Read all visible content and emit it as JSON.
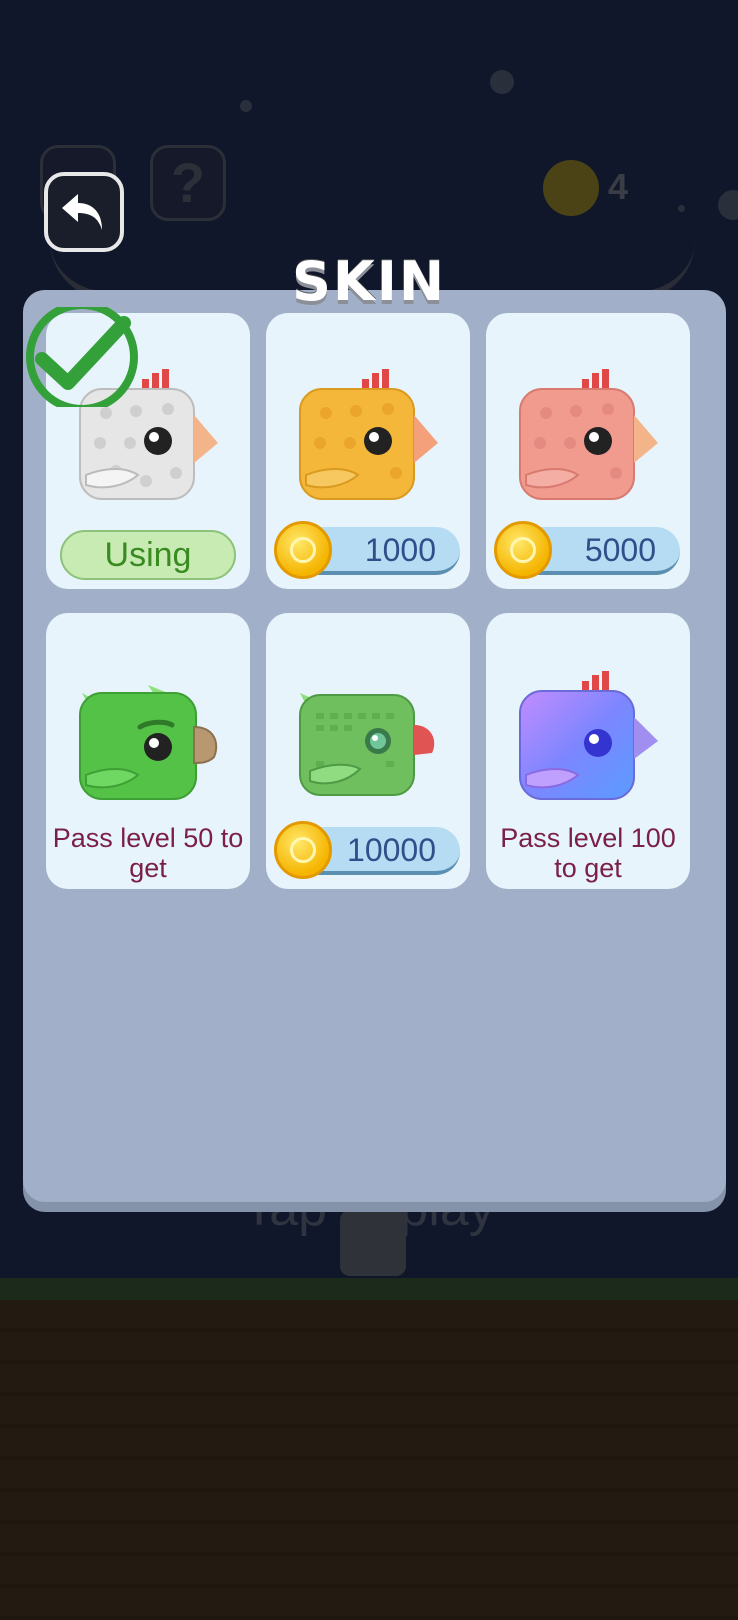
{
  "background": {
    "coin_count": "4",
    "tap_text": "Tap to play",
    "help_glyph": "?"
  },
  "title": "SKIN",
  "skins": [
    {
      "name": "white-chick",
      "status": "Using",
      "selected": true,
      "color": "#e6e6e6",
      "icon": "check-icon"
    },
    {
      "name": "yellow-chick",
      "price": "1000",
      "color": "#f5b73a"
    },
    {
      "name": "pink-chick",
      "price": "5000",
      "color": "#f19a8e"
    },
    {
      "name": "green-parrot",
      "requirement": "Pass level 50 to get",
      "color": "#53c247"
    },
    {
      "name": "green-bird",
      "price": "10000",
      "color": "#6fbf5e"
    },
    {
      "name": "blue-bird",
      "requirement": "Pass level 100 to get",
      "color": "#8a7cff"
    }
  ],
  "icons": {
    "back": "back-arrow-icon",
    "coin": "coin-icon",
    "check": "check-icon"
  }
}
